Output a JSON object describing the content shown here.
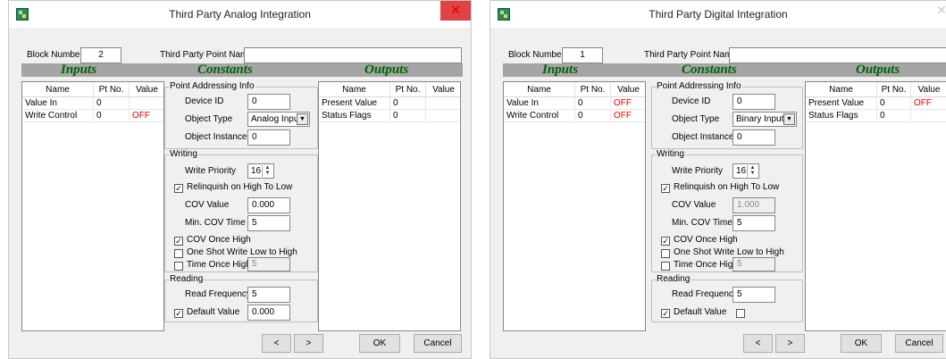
{
  "left": {
    "title": "Third Party Analog Integration",
    "block_number_label": "Block Number:",
    "block_number": "2",
    "point_name_label": "Third Party Point Name:",
    "point_name": "",
    "band": {
      "inputs": "Inputs",
      "constants": "Constants",
      "outputs": "Outputs"
    },
    "inputs_table": {
      "headers": [
        "Name",
        "Pt No.",
        "Value"
      ],
      "rows": [
        [
          "Value In",
          "0",
          ""
        ],
        [
          "Write Control",
          "0",
          "OFF"
        ]
      ]
    },
    "outputs_table": {
      "headers": [
        "Name",
        "Pt No.",
        "Value"
      ],
      "rows": [
        [
          "Present Value",
          "0",
          ""
        ],
        [
          "Status Flags",
          "0",
          ""
        ]
      ]
    },
    "point_addressing": {
      "legend": "Point Addressing Info",
      "device_id_label": "Device ID",
      "device_id": "0",
      "object_type_label": "Object Type",
      "object_type": "Analog Input",
      "object_instance_label": "Object Instance",
      "object_instance": "0"
    },
    "writing": {
      "legend": "Writing",
      "write_priority_label": "Write Priority",
      "write_priority": "16",
      "relinquish_label": "Relinquish on High To Low",
      "relinquish_checked": true,
      "cov_value_label": "COV Value",
      "cov_value": "0.000",
      "min_cov_time_label": "Min. COV Time",
      "min_cov_time": "5",
      "cov_once_high_label": "COV Once High",
      "cov_once_high_checked": true,
      "one_shot_label": "One Shot Write Low to High",
      "one_shot_checked": false,
      "time_once_high_label": "Time Once High",
      "time_once_high_checked": false,
      "time_once_high": "5"
    },
    "reading": {
      "legend": "Reading",
      "read_frequency_label": "Read Frequency",
      "read_frequency": "5",
      "default_value_label": "Default Value",
      "default_value_checked": true,
      "default_value": "0.000"
    },
    "buttons": {
      "prev": "<",
      "next": ">",
      "ok": "OK",
      "cancel": "Cancel"
    }
  },
  "right": {
    "title": "Third Party Digital Integration",
    "block_number_label": "Block Number:",
    "block_number": "1",
    "point_name_label": "Third Party Point Name:",
    "point_name": "",
    "band": {
      "inputs": "Inputs",
      "constants": "Constants",
      "outputs": "Outputs"
    },
    "inputs_table": {
      "headers": [
        "Name",
        "Pt No.",
        "Value"
      ],
      "rows": [
        [
          "Value In",
          "0",
          "OFF"
        ],
        [
          "Write Control",
          "0",
          "OFF"
        ]
      ]
    },
    "outputs_table": {
      "headers": [
        "Name",
        "Pt No.",
        "Value"
      ],
      "rows": [
        [
          "Present Value",
          "0",
          "OFF"
        ],
        [
          "Status Flags",
          "0",
          ""
        ]
      ]
    },
    "point_addressing": {
      "legend": "Point Addressing Info",
      "device_id_label": "Device ID",
      "device_id": "0",
      "object_type_label": "Object Type",
      "object_type": "Binary Input",
      "object_instance_label": "Object Instance",
      "object_instance": "0"
    },
    "writing": {
      "legend": "Writing",
      "write_priority_label": "Write Priority",
      "write_priority": "16",
      "relinquish_label": "Relinquish on High To Low",
      "relinquish_checked": true,
      "cov_value_label": "COV Value",
      "cov_value": "1.000",
      "min_cov_time_label": "Min. COV Time",
      "min_cov_time": "5",
      "cov_once_high_label": "COV Once High",
      "cov_once_high_checked": true,
      "one_shot_label": "One Shot Write Low to High",
      "one_shot_checked": false,
      "time_once_high_label": "Time Once High",
      "time_once_high_checked": false,
      "time_once_high": "5"
    },
    "reading": {
      "legend": "Reading",
      "read_frequency_label": "Read Frequency",
      "read_frequency": "5",
      "default_value_label": "Default Value",
      "default_value_checked": true,
      "default_value_box_checked": false
    },
    "buttons": {
      "prev": "<",
      "next": ">",
      "ok": "OK",
      "cancel": "Cancel"
    }
  },
  "colors": {
    "band": "#a5a5a5",
    "band_text": "#006400",
    "off_text": "#e00000",
    "close_button": "#e04343"
  },
  "icons": {
    "close": "close-icon",
    "app": "app-icon",
    "check": "checkmark-icon",
    "dropdown": "chevron-down-icon",
    "spin_up": "spin-up-icon",
    "spin_down": "spin-down-icon"
  }
}
